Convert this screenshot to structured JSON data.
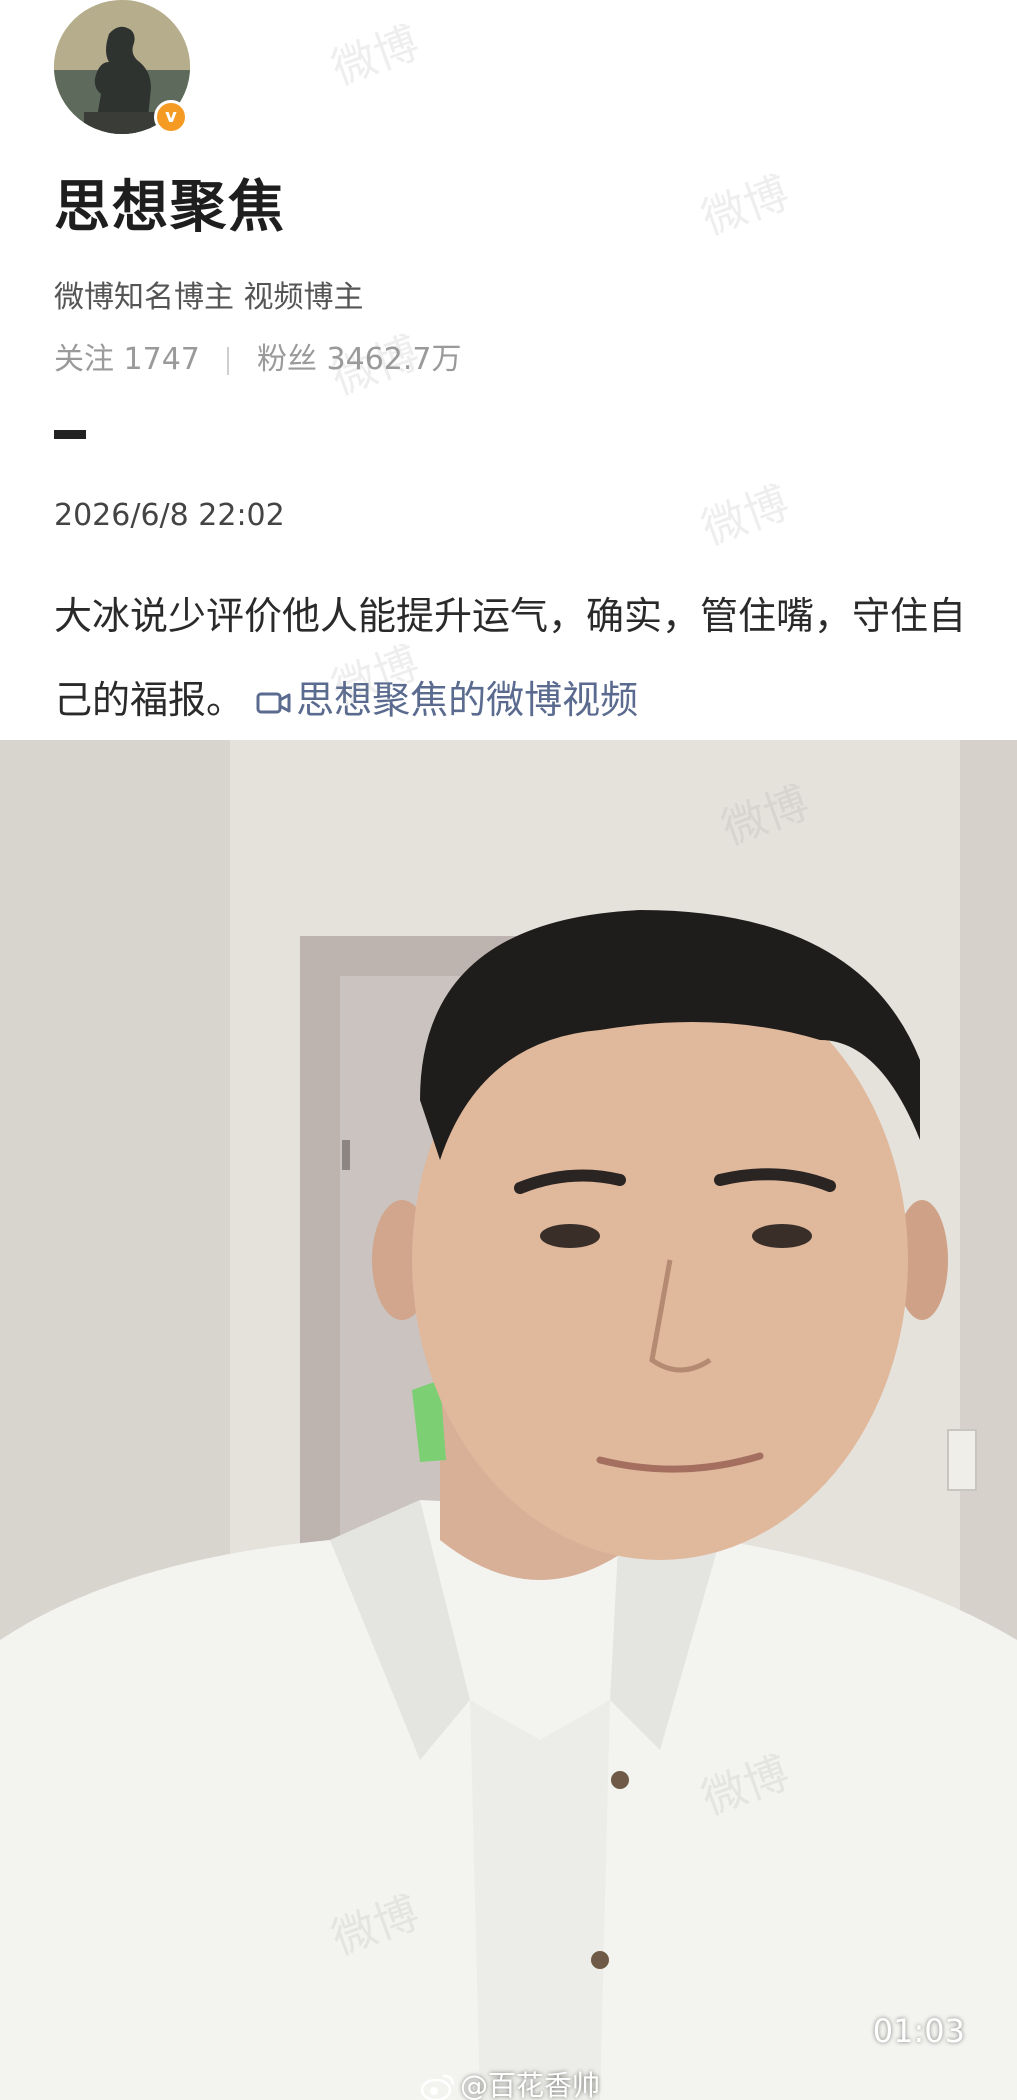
{
  "profile": {
    "name": "思想聚焦",
    "verified_badge": "v",
    "tags": "微博知名博主 视频博主",
    "following_label": "关注",
    "following_count": "1747",
    "followers_label": "粉丝",
    "followers_count": "3462.7万"
  },
  "post": {
    "date": "2026/6/8 22:02",
    "text": "大冰说少评价他人能提升运气，确实，管住嘴，守住自己的福报。",
    "video_link": "思想聚焦的微博视频"
  },
  "video": {
    "duration": "01:03",
    "source_handle": "@百花香帅"
  },
  "watermark": "微博",
  "colors": {
    "badge": "#f59a23",
    "link": "#5a6b8f",
    "shirt": "#f3f3f0"
  },
  "icons": [
    "thinker-avatar",
    "verified-badge-icon",
    "video-camera-icon",
    "weibo-logo-icon"
  ]
}
